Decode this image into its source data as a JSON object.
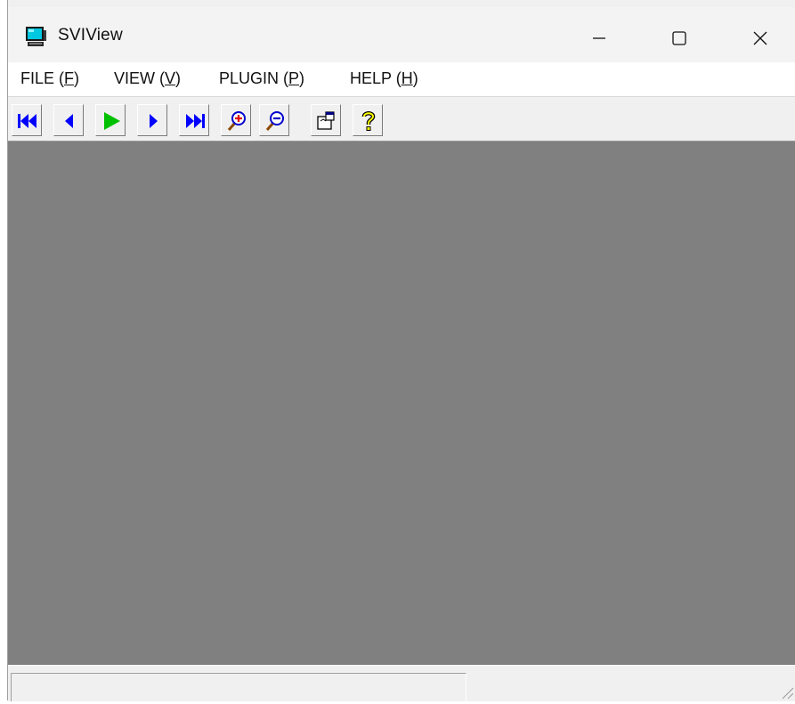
{
  "window": {
    "title": "SVIView"
  },
  "menubar": {
    "items": [
      {
        "label": "FILE (",
        "key": "F",
        "suffix": ")"
      },
      {
        "label": "VIEW (",
        "key": "V",
        "suffix": ")"
      },
      {
        "label": "PLUGIN (",
        "key": "P",
        "suffix": ")"
      },
      {
        "label": "HELP (",
        "key": "H",
        "suffix": ")"
      }
    ]
  },
  "toolbar": {
    "buttons": [
      {
        "icon": "first-frame-icon"
      },
      {
        "icon": "previous-frame-icon"
      },
      {
        "icon": "play-icon"
      },
      {
        "icon": "next-frame-icon"
      },
      {
        "icon": "last-frame-icon"
      },
      {
        "icon": "zoom-in-icon"
      },
      {
        "icon": "zoom-out-icon"
      },
      {
        "icon": "properties-icon"
      },
      {
        "icon": "help-icon"
      }
    ]
  },
  "colors": {
    "client_background": "#808080",
    "nav_blue": "#0000ff",
    "play_green": "#00c000",
    "help_yellow": "#ffff00"
  },
  "statusbar": {
    "text": ""
  }
}
